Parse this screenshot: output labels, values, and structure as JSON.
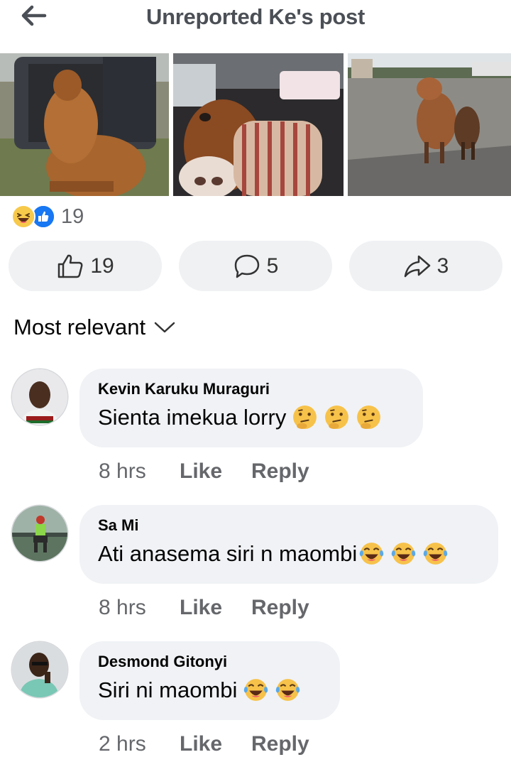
{
  "header": {
    "title": "Unreported Ke's post",
    "back_icon": "arrow-left-icon"
  },
  "photos": [
    {
      "icon": "cow-in-car-trunk-photo"
    },
    {
      "icon": "cow-in-car-seat-photo"
    },
    {
      "icon": "cows-on-road-photo"
    }
  ],
  "reactions": {
    "count": "19",
    "icons": [
      "laughing-emoji-icon",
      "thumbs-up-reaction-icon"
    ]
  },
  "actions": {
    "like": {
      "count": "19",
      "icon": "thumbs-up-icon"
    },
    "comment": {
      "count": "5",
      "icon": "comment-icon"
    },
    "share": {
      "count": "3",
      "icon": "share-icon"
    }
  },
  "sort": {
    "label": "Most relevant",
    "icon": "chevron-down-icon"
  },
  "comments": [
    {
      "name": "Kevin Karuku Muraguri",
      "text": "Sienta imekua lorry",
      "emoji": "thinking-face",
      "emoji_count": 3,
      "time": "8 hrs",
      "like": "Like",
      "reply": "Reply"
    },
    {
      "name": "Sa Mi",
      "text": "Ati anasema siri n maombi",
      "emoji": "tears-of-joy",
      "emoji_count": 3,
      "time": "8 hrs",
      "like": "Like",
      "reply": "Reply"
    },
    {
      "name": "Desmond Gitonyi",
      "text": "Siri ni maombi ",
      "emoji": "tears-of-joy",
      "emoji_count": 2,
      "time": "2 hrs",
      "like": "Like",
      "reply": "Reply"
    }
  ],
  "colors": {
    "accent": "#1877f2",
    "secondary_text": "#65676b",
    "pill_bg": "#eff1f3",
    "bubble_bg": "#f0f2f5"
  }
}
